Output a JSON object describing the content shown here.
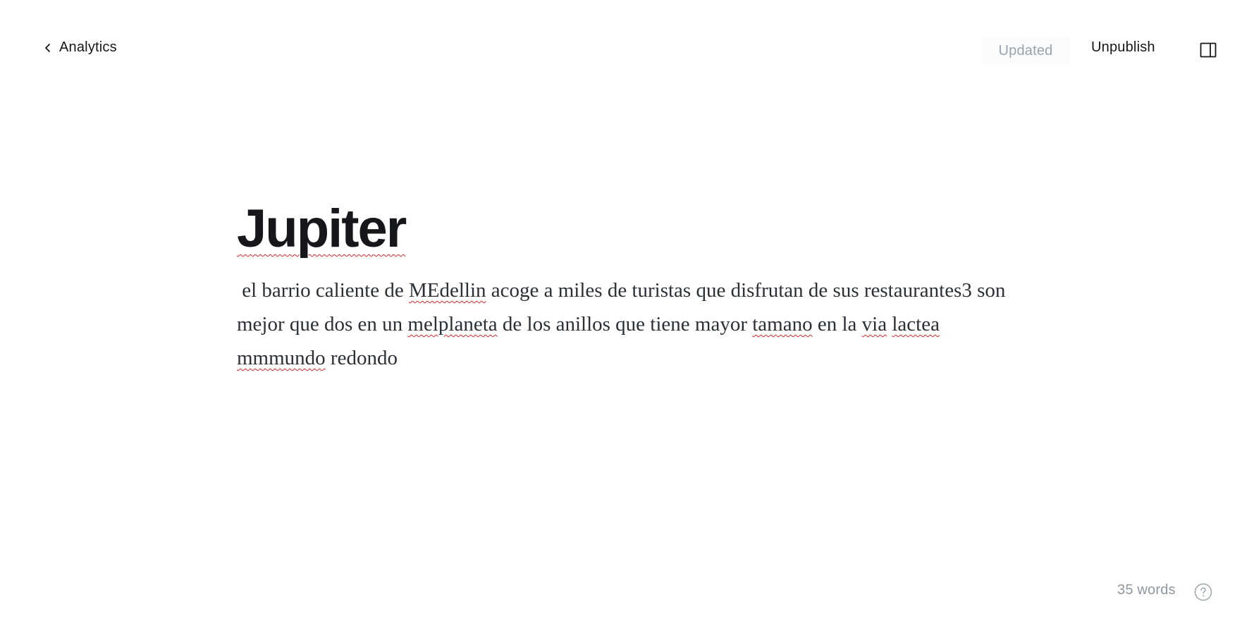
{
  "header": {
    "back_label": "Analytics",
    "status_label": "Updated",
    "unpublish_label": "Unpublish"
  },
  "post": {
    "title": "Jupiter",
    "body": {
      "s0": " el barrio caliente de ",
      "w1": "MEdellin",
      "s1": " acoge a miles de turistas que disfrutan de sus restaurantes3 son mejor que dos en un ",
      "w2": "melplaneta",
      "s2": " de los anillos que tiene mayor ",
      "w3": "tamano",
      "s3": " en la ",
      "w4": "via",
      "s4": " ",
      "w5": "lactea",
      "s5": "  ",
      "w6": "mmmundo",
      "s6": " redondo"
    }
  },
  "footer": {
    "word_count": "35 words"
  },
  "icons": {
    "back": "chevron-left-icon",
    "sidebar": "sidebar-toggle-icon",
    "help": "question-circle-icon"
  }
}
